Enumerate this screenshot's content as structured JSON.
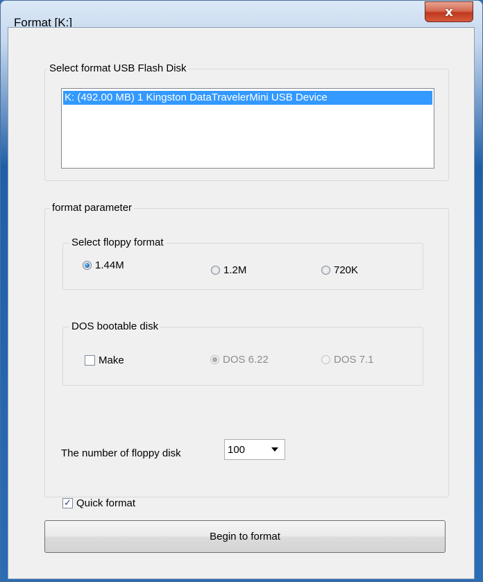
{
  "window": {
    "title": "Format [K:]",
    "close_label": "x"
  },
  "usb_group": {
    "legend": "Select format USB Flash Disk",
    "devices": [
      "K: (492.00 MB) 1 Kingston DataTravelerMini USB Device"
    ],
    "selected_index": 0
  },
  "params_group": {
    "legend": "format parameter",
    "floppy_group": {
      "legend": "Select floppy format",
      "options": [
        "1.44M",
        "1.2M",
        "720K"
      ],
      "selected": "1.44M"
    },
    "dos_group": {
      "legend": "DOS bootable disk",
      "make_label": "Make",
      "make_checked": false,
      "options": [
        "DOS 6.22",
        "DOS 7.1"
      ],
      "selected": "DOS 6.22",
      "options_enabled": false
    },
    "count_label": "The number of floppy disk",
    "count_value": "100",
    "quick_format_label": "Quick format",
    "quick_format_checked": true,
    "check_mark": "✓"
  },
  "begin_button": "Begin to format",
  "colors": {
    "selection": "#3399ff",
    "title_bar": "#c5d7ee",
    "close_button": "#c0391f"
  }
}
